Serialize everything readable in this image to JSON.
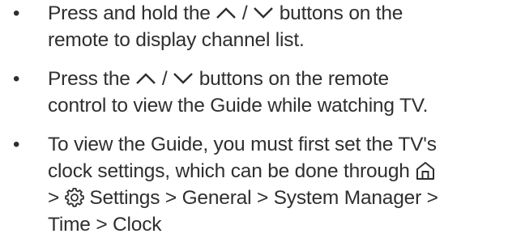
{
  "bullets": [
    {
      "marker": "•",
      "line1_pre": "Press and hold the ",
      "slash": "/",
      "line1_post": " buttons on the",
      "line2": "remote to display channel list."
    },
    {
      "marker": "•",
      "line1_pre": "Press the ",
      "slash": "/",
      "line1_post": " buttons on the remote",
      "line2": "control to view the Guide while watching TV."
    },
    {
      "marker": "•",
      "line1": "To view the Guide, you must first set the TV's",
      "line2_pre": "clock settings, which can be done through ",
      "line3_sep": ">",
      "line3_post": " Settings > General > System Manager >",
      "line4": "Time > Clock"
    }
  ],
  "icons": {
    "up": "chevron-up-icon",
    "down": "chevron-down-icon",
    "home": "home-icon",
    "settings": "gear-icon"
  },
  "colors": {
    "text": "#2f2f2f",
    "background": "#ffffff"
  }
}
